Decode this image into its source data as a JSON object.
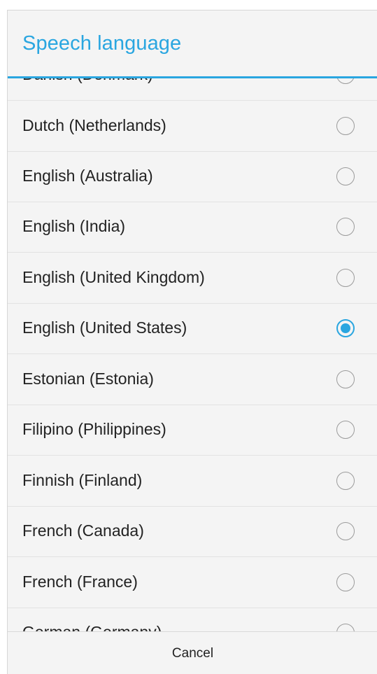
{
  "dialog": {
    "title": "Speech language",
    "accent_color": "#2aa6e0",
    "cancel_label": "Cancel"
  },
  "languages": [
    {
      "label": "Danish (Denmark)",
      "selected": false
    },
    {
      "label": "Dutch (Netherlands)",
      "selected": false
    },
    {
      "label": "English (Australia)",
      "selected": false
    },
    {
      "label": "English (India)",
      "selected": false
    },
    {
      "label": "English (United Kingdom)",
      "selected": false
    },
    {
      "label": "English (United States)",
      "selected": true
    },
    {
      "label": "Estonian (Estonia)",
      "selected": false
    },
    {
      "label": "Filipino (Philippines)",
      "selected": false
    },
    {
      "label": "Finnish (Finland)",
      "selected": false
    },
    {
      "label": "French (Canada)",
      "selected": false
    },
    {
      "label": "French (France)",
      "selected": false
    },
    {
      "label": "German (Germany)",
      "selected": false
    }
  ]
}
